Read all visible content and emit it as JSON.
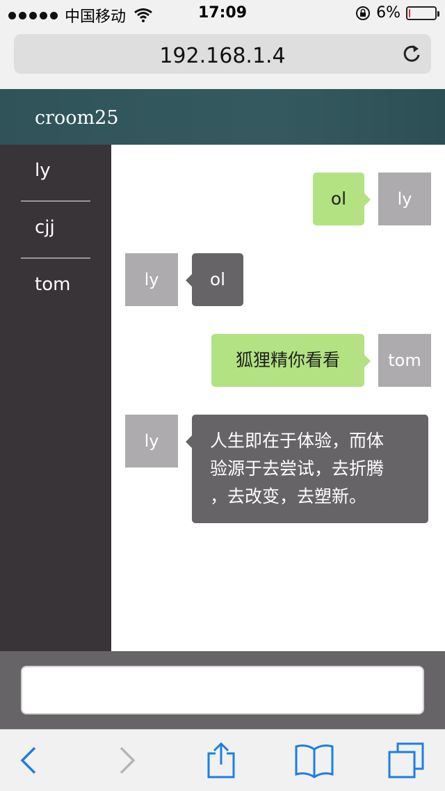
{
  "status_bar": {
    "carrier": "中国移动",
    "time": "17:09",
    "battery_percent": "6%",
    "battery_level": 0.06,
    "icons": [
      "signal-dots-icon",
      "wifi-icon",
      "rotation-lock-icon",
      "battery-icon"
    ]
  },
  "browser": {
    "url": "192.168.1.4",
    "toolbar_icons": [
      "back-icon",
      "forward-icon",
      "share-icon",
      "bookmarks-icon",
      "tabs-icon"
    ]
  },
  "header": {
    "title": "croom25"
  },
  "sidebar": {
    "users": [
      {
        "label": "ly"
      },
      {
        "label": "cjj"
      },
      {
        "label": "tom"
      }
    ]
  },
  "messages": [
    {
      "sender": "ly",
      "text": "ol",
      "side": "right"
    },
    {
      "sender": "ly",
      "text": "ol",
      "side": "left"
    },
    {
      "sender": "tom",
      "text": "狐狸精你看看",
      "side": "right"
    },
    {
      "sender": "ly",
      "text_lines": [
        "人生即在于体验，而体",
        "验源于去尝试，去折腾",
        "，去改变，去塑新。"
      ],
      "side": "left"
    }
  ],
  "composer": {
    "value": "",
    "placeholder": ""
  },
  "colors": {
    "header_bg": "#345a60",
    "sidebar_bg": "#383438",
    "bubble_self": "#b2e281",
    "bubble_other": "#676468",
    "avatar_bg": "#aeabaf",
    "ios_blue": "#1b7fe3"
  }
}
